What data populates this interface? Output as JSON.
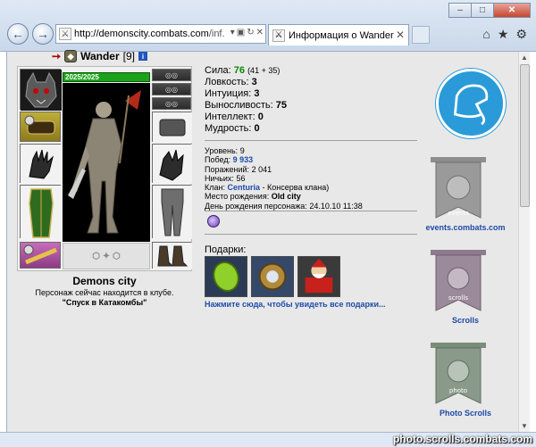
{
  "browser": {
    "address_host": "http://demonscity.combats.com",
    "address_path": "/inf.",
    "tab_title": "Информация о Wander",
    "tab_favicon": "crossed-swords-icon"
  },
  "character": {
    "name": "Wander",
    "level": "[9]",
    "hp": "2025/2025"
  },
  "location": {
    "city": "Demons city",
    "club_note": "Персонаж сейчас находится в клубе.",
    "club_name": "\"Спуск в Катакомбы\""
  },
  "stats": [
    {
      "label": "Сила:",
      "value": "76",
      "extra": "(41 + 35)",
      "highlight": true
    },
    {
      "label": "Ловкость:",
      "value": "3",
      "extra": "",
      "highlight": false
    },
    {
      "label": "Интуиция:",
      "value": "3",
      "extra": "",
      "highlight": false
    },
    {
      "label": "Выносливость:",
      "value": "75",
      "extra": "",
      "highlight": false
    },
    {
      "label": "Интеллект:",
      "value": "0",
      "extra": "",
      "highlight": false
    },
    {
      "label": "Мудрость:",
      "value": "0",
      "extra": "",
      "highlight": false
    }
  ],
  "info": {
    "level_label": "Уровень:",
    "level_value": "9",
    "wins_label": "Побед:",
    "wins_value": "9 933",
    "losses_label": "Поражений:",
    "losses_value": "2 041",
    "draws_label": "Ничьих:",
    "draws_value": "56",
    "clan_label": "Клан:",
    "clan_value": "Centuria",
    "clan_suffix": "- Консерва клана)",
    "birthplace_label": "Место рождения:",
    "birthplace_value": "Old city",
    "birthday_label": "День рождения персонажа:",
    "birthday_value": "24.10.10 11:38"
  },
  "gifts": {
    "title": "Подарки:",
    "link": "Нажмите сюда, чтобы увидеть все подарки..."
  },
  "sidebar": {
    "events_label": "events.combats.com",
    "scrolls_label": "Scrolls",
    "photo_label": "Photo Scrolls",
    "banner_events_word": "events",
    "banner_scrolls_word": "scrolls",
    "banner_photo_word": "photo"
  },
  "watermark": "photo.scrolls.combats.com",
  "colors": {
    "link_blue": "#1f4aa8",
    "strength_green": "#0a8a0a",
    "hp_green": "#1aa31a",
    "logo_blue": "#2a9bd8",
    "banner_gray": "#8e8e8e"
  }
}
